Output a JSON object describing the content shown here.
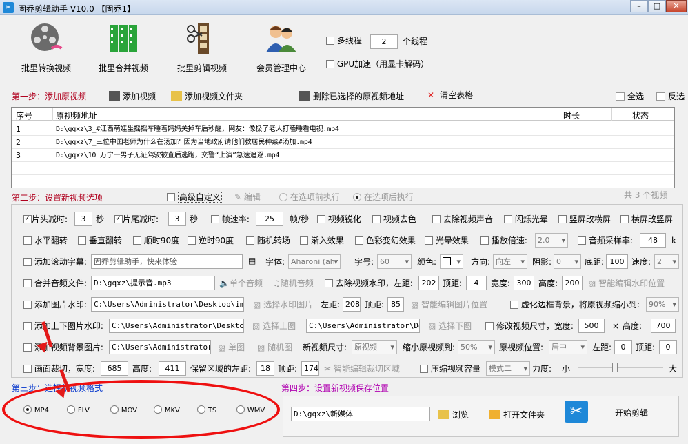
{
  "window": {
    "title": "固乔剪辑助手 V10.0  【固乔1】"
  },
  "toolbar": {
    "tools": [
      {
        "label": "批里转换视频"
      },
      {
        "label": "批里合并视频"
      },
      {
        "label": "批里剪辑视频"
      },
      {
        "label": "会员管理中心"
      }
    ],
    "multithread_label": "多线程",
    "thread_count": "2",
    "thread_unit": "个线程",
    "gpu_label": "GPU加速（用显卡解码）"
  },
  "step1": {
    "title": "第一步：添加原视频",
    "add_video": "添加视频",
    "add_folder": "添加视频文件夹",
    "delete_selected": "删除已选择的原视频地址",
    "clear_table": "清空表格",
    "select_all": "全选",
    "invert": "反选"
  },
  "table": {
    "columns": [
      "序号",
      "原视频地址",
      "时长",
      "状态"
    ],
    "rows": [
      {
        "no": "1",
        "path": "D:\\gqxz\\3_#江西萌娃坐摇摇车睡着妈妈关掉车后秒醒，网友：像极了老人打瞌睡看电视.mp4"
      },
      {
        "no": "2",
        "path": "D:\\gqxz\\7_三位中国老师为什么在汤加？因为当地政府请他们教居民种菜#汤加.mp4"
      },
      {
        "no": "3",
        "path": "D:\\gqxz\\10_万宁一男子无证驾驶被查后逃跑，交警“上演”急速追逐.mp4"
      }
    ]
  },
  "step2": {
    "title": "第二步：设置新视频选项",
    "advanced": "高级自定义",
    "edit": "编辑",
    "before": "在选项前执行",
    "after": "在选项后执行",
    "total": "共 3 个视频"
  },
  "row1": {
    "head_cut": "片头减时:",
    "head_val": "3",
    "sec1": "秒",
    "tail_cut": "片尾减时:",
    "tail_val": "3",
    "sec2": "秒",
    "fps_label": "帧速率:",
    "fps_val": "25",
    "fps_unit": "帧/秒",
    "sharpen": "视频锐化",
    "decolor": "视频去色",
    "mute": "去除视频声音",
    "flash": "闪烁光晕",
    "v2h": "竖屏改横屏",
    "h2v": "横屏改竖屏"
  },
  "row2": {
    "hflip": "水平翻转",
    "vflip": "垂直翻转",
    "cw90": "顺时90度",
    "ccw90": "逆时90度",
    "random_trans": "随机转场",
    "fade_in": "渐入效果",
    "color": "色彩变幻效果",
    "glow": "光晕效果",
    "speed": "播放倍速:",
    "speed_val": "2.0",
    "sample": "音频采样率:",
    "sample_val": "48",
    "sample_unit": "k"
  },
  "row3": {
    "scroll": "添加滚动字幕:",
    "scroll_text": "固乔剪辑助手，快来体验",
    "font": "字体:",
    "font_val": "Aharoni (ahr",
    "size": "字号:",
    "size_val": "60",
    "color": "颜色:",
    "direction": "方向:",
    "direction_val": "向左",
    "shadow": "阴影:",
    "shadow_val": "0",
    "bottom": "底距:",
    "bottom_val": "100",
    "speed": "速度:",
    "speed_val": "2"
  },
  "row4": {
    "merge_audio": "合并音频文件:",
    "audio_path": "D:\\gqxz\\提示音.mp3",
    "single_audio": "单个音频",
    "random_audio": "随机音频",
    "remove_wm": "去除视频水印，左距:",
    "left": "202",
    "top_label": "顶距:",
    "top": "4",
    "width_label": "宽度:",
    "width": "300",
    "height_label": "高度:",
    "height": "200",
    "smart_wm": "智能编辑水印位置"
  },
  "row5": {
    "img_wm": "添加图片水印:",
    "img_path": "C:\\Users\\Administrator\\Desktop\\img-q",
    "choose": "选择水印图片",
    "left_label": "左距:",
    "left": "208",
    "top_label": "顶距:",
    "top": "85",
    "smart": "智能编辑图片位置",
    "blur": "虚化边框背景，将原视频缩小到:",
    "blur_val": "90%"
  },
  "row6": {
    "tb_wm": "添加上下图片水印:",
    "top_path": "C:\\Users\\Administrator\\Desktop\\i",
    "choose_top": "选择上图",
    "bot_path": "C:\\Users\\Administrator\\Desk",
    "choose_bot": "选择下图",
    "resize": "修改视频尺寸，宽度:",
    "w": "500",
    "x": "×",
    "h_label": "高度:",
    "h": "700"
  },
  "row7": {
    "bg": "添加视频背景图片:",
    "bg_path": "C:\\Users\\Administrator\\D",
    "single": "单图",
    "random": "随机图",
    "new_size": "新视频尺寸:",
    "new_size_val": "原视频",
    "shrink": "缩小原视频到:",
    "shrink_val": "50%",
    "pos": "原视频位置:",
    "pos_val": "居中",
    "left_label": "左距:",
    "left": "0",
    "top_label": "顶距:",
    "top": "0"
  },
  "row8": {
    "crop": "画面裁切，宽度:",
    "w": "685",
    "h_label": "高度:",
    "h": "411",
    "keep_left": "保留区域的左距:",
    "left": "18",
    "top_label": "顶距:",
    "top": "174",
    "smart": "智能编辑裁切区域",
    "compress": "压缩视频容量",
    "mode": "模式二",
    "strength": "力度:",
    "small": "小",
    "big": "大"
  },
  "step3": {
    "title": "第三步：选择新视频格式",
    "formats": [
      "MP4",
      "FLV",
      "MOV",
      "MKV",
      "TS",
      "WMV"
    ],
    "selected": "MP4"
  },
  "step4": {
    "title": "第四步：设置新视频保存位置",
    "path": "D:\\gqxz\\新媒体",
    "browse": "浏览",
    "open_folder": "打开文件夹",
    "start": "开始剪辑"
  },
  "colors": {
    "step": "#b0001e",
    "step4": "#b000b0",
    "annotation": "#ee1010"
  }
}
